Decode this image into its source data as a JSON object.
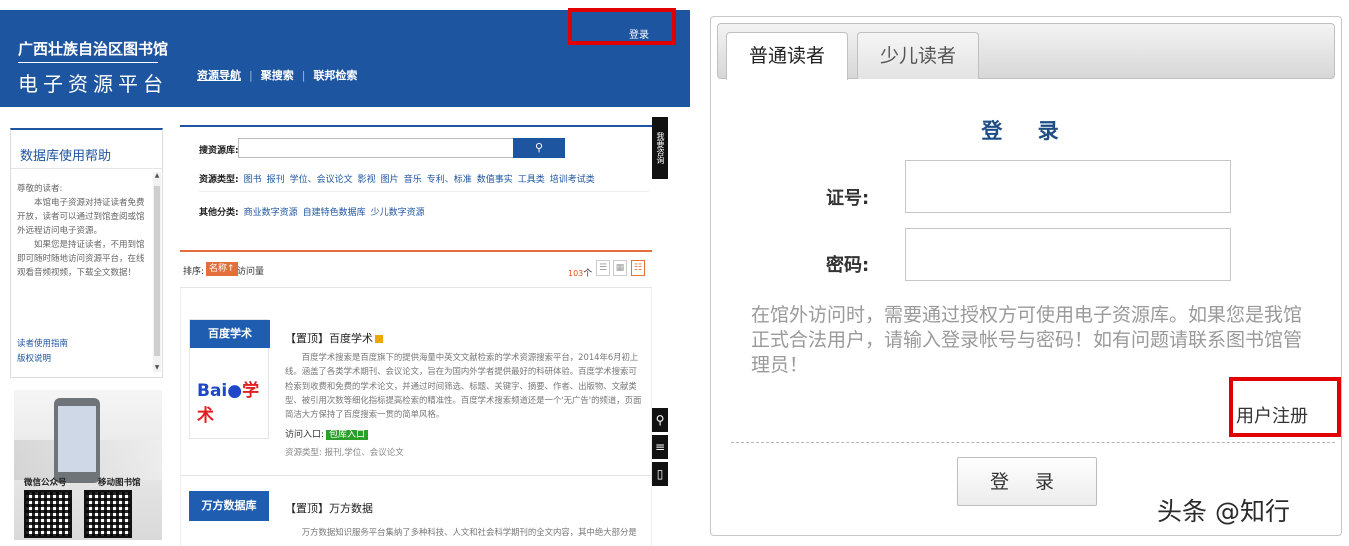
{
  "left": {
    "brand_line1": "广西壮族自治区图书馆",
    "brand_line2": "电子资源平台",
    "nav": [
      "资源导航",
      "聚搜索",
      "联邦检索"
    ],
    "login_link": "登录",
    "help": {
      "title": "数据库使用帮助",
      "text": [
        "尊敬的读者:",
        "本馆电子资源对持证读者免费开放，读者可以通过到馆查阅或馆外远程访问电子资源。",
        "如果您是持证读者，不用到馆即可随时随地访问资源平台，在线观看音频视频，下载全文数据！"
      ],
      "links": [
        "读者使用指南",
        "版权说明"
      ]
    },
    "promo": {
      "wechat": "微信公众号",
      "mobile": "移动图书馆"
    },
    "search": {
      "label": "搜资源库:",
      "input_value": "",
      "type_label": "资源类型:",
      "types": [
        "图书",
        "报刊",
        "学位、会议论文",
        "影视",
        "图片",
        "音乐",
        "专利、标准",
        "数值事实",
        "工具类",
        "培训考试类"
      ],
      "other_label": "其他分类:",
      "others": [
        "商业数字资源",
        "自建特色数据库",
        "少儿数字资源"
      ]
    },
    "sort": {
      "label": "排序:",
      "active": "名称↑",
      "visits": "访问量",
      "count": "103",
      "count_unit": "个"
    },
    "results": [
      {
        "logo_tag": "百度学术",
        "title": "【置顶】百度学术",
        "desc": "百度学术搜索是百度旗下的提供海量中英文文献检索的学术资源搜索平台，2014年6月初上线。涵盖了各类学术期刊、会议论文，旨在为国内外学者提供最好的科研体验。百度学术搜索可检索到收费和免费的学术论文，并通过时间筛选、标题、关键字、摘要、作者、出版物、文献类型、被引用次数等细化指标提高检索的精准性。百度学术搜索频道还是一个'无广告'的频道，页面简洁大方保持了百度搜索一贯的简单风格。",
        "access_label": "访问入口:",
        "access_badge": "包库入口",
        "type": "资源类型: 报刊,学位、会议论文"
      },
      {
        "logo_tag": "万方数据库",
        "title": "【置顶】万方数据",
        "desc": "万方数据知识服务平台集纳了多种科技、人文和社会科学期刊的全文内容，其中绝大部分是进入科技部科技论"
      }
    ],
    "side_tab": "我要咨询"
  },
  "right": {
    "tabs": [
      "普通读者",
      "少儿读者"
    ],
    "title": "登 录",
    "id_label": "证号:",
    "pwd_label": "密码:",
    "id_value": "",
    "pwd_value": "",
    "notice": "在馆外访问时，需要通过授权方可使用电子资源库。如果您是我馆正式合法用户，请输入登录帐号与密码！如有问题请联系图书馆管理员！",
    "register": "用户注册",
    "login_button": "登 录",
    "watermark": "头条 @知行"
  },
  "colors": {
    "header_blue": "#1e55a0",
    "highlight_red": "#e00000",
    "sort_orange": "#e36f3a",
    "title_blue": "#1e4d86"
  }
}
